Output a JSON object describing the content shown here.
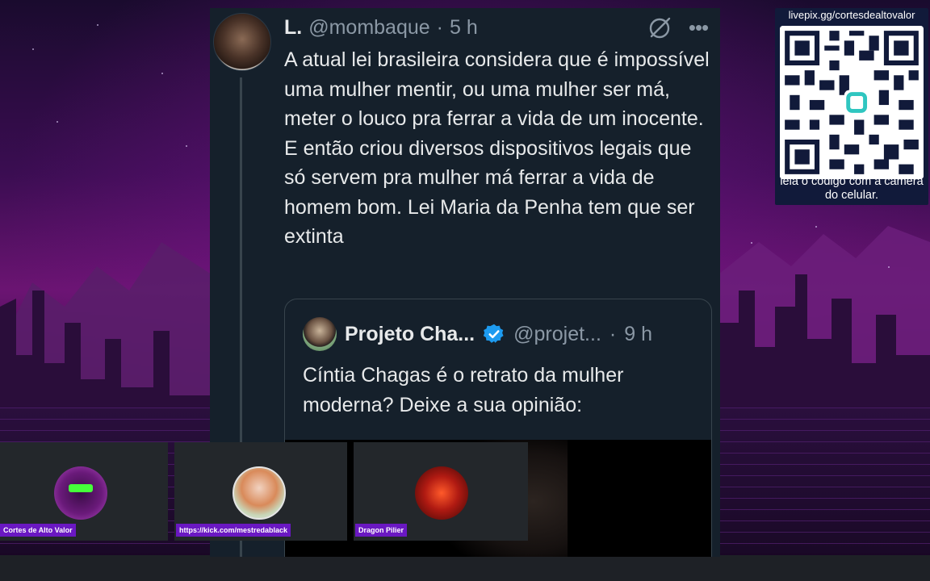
{
  "tweet": {
    "display_name": "L.",
    "handle": "@mombaque",
    "separator": "·",
    "time": "5 h",
    "more_label": "•••",
    "text": "A atual lei brasileira considera que é impossível uma mulher mentir, ou uma mulher ser má, meter o louco pra ferrar a vida de um inocente. E então criou diversos dispositivos legais que só servem pra mulher má ferrar a vida de homem bom. Lei Maria da Penha tem que ser extinta",
    "quote": {
      "display_name": "Projeto Cha...",
      "handle": "@projet...",
      "separator": "·",
      "time": "9 h",
      "verified": true,
      "verified_color": "#1d9bf0",
      "text": "Cíntia Chagas é o retrato da mulher moderna? Deixe a sua opinião:"
    }
  },
  "qr_panel": {
    "url": "livepix.gg/cortesdealtovalor",
    "caption": "leia o código com a câmera do celular."
  },
  "cams": [
    {
      "label": "Cortes de Alto Valor"
    },
    {
      "label": "https://kick.com/mestredablack"
    },
    {
      "label": "Dragon Pilier"
    }
  ],
  "colors": {
    "tweet_bg": "#15202b",
    "text_primary": "#e7e9ea",
    "text_secondary": "#8b98a5",
    "cam_label_bg": "#6a18c2"
  },
  "icons": [
    "grok-icon",
    "more-icon",
    "verified-badge-icon",
    "qr-code"
  ]
}
